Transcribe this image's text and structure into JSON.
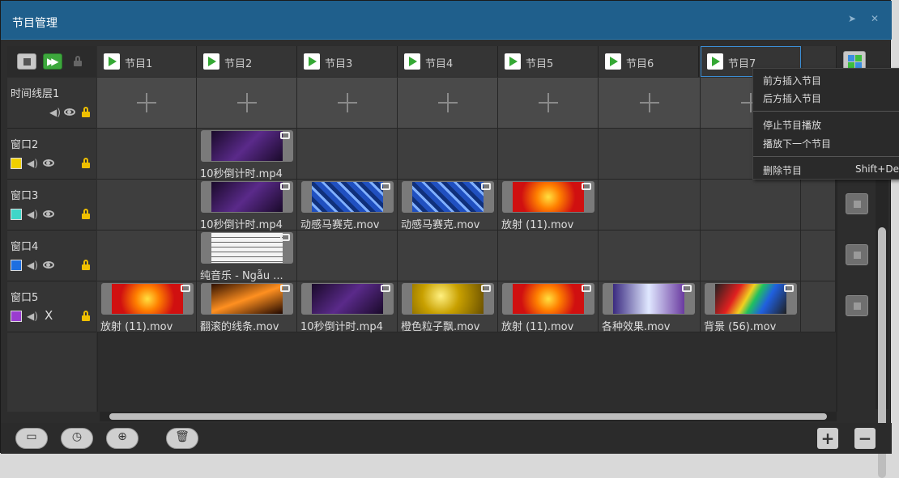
{
  "window": {
    "title": "节目管理",
    "pin_icon": "pin-icon",
    "close_icon": "close-icon"
  },
  "columns": [
    "节目1",
    "节目2",
    "节目3",
    "节目4",
    "节目5",
    "节目6",
    "节目7"
  ],
  "rows": [
    {
      "name": "时间线层1",
      "color": null
    },
    {
      "name": "窗口2",
      "color": "#f0d000"
    },
    {
      "name": "窗口3",
      "color": "#3fd6c8"
    },
    {
      "name": "窗口4",
      "color": "#1e6fe0"
    },
    {
      "name": "窗口5",
      "color": "#9a3cd0"
    }
  ],
  "clips": {
    "r2c2": "10秒倒计时.mp4",
    "r3c2": "10秒倒计时.mp4",
    "r3c3": "动感马赛克.mov",
    "r3c4": "动感马赛克.mov",
    "r3c5": "放射 (11).mov",
    "r4c2": "纯音乐 - Ngẫu ...",
    "r5c1": "放射 (11).mov",
    "r5c2": "翻滚的线条.mov",
    "r5c3": "10秒倒计时.mp4",
    "r5c4": "橙色粒子飘.mov",
    "r5c5": "放射 (11).mov",
    "r5c6": "各种效果.mov",
    "r5c7": "背景 (56).mov"
  },
  "context_menu": {
    "insert_before": "前方插入节目",
    "insert_after": "后方插入节目",
    "stop_program": "停止节目播放",
    "play_next": "播放下一个节目",
    "delete_program": "删除节目",
    "delete_shortcut": "Shift+Del"
  },
  "row5_visibility_text": "X",
  "bottom": {
    "add": "+",
    "remove": "−"
  }
}
